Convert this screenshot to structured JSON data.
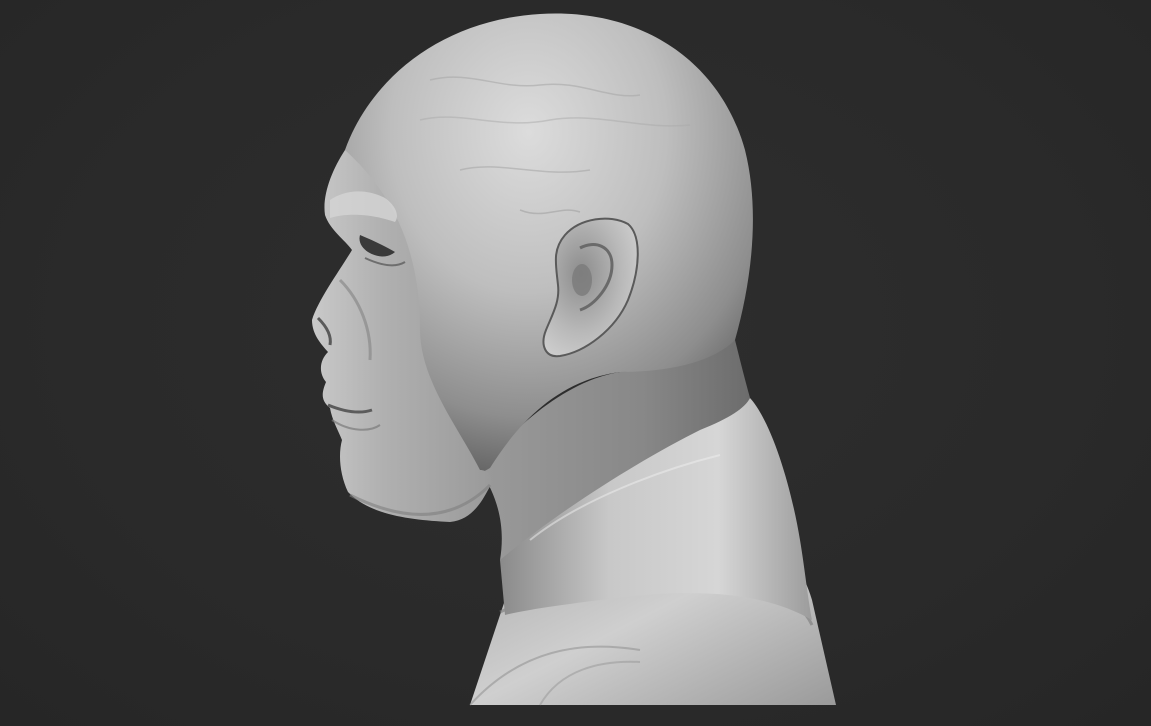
{
  "scene": {
    "subject": "sculpt-bust-profile",
    "background_color": "#2b2b2b",
    "material_color": "#bdbdbd"
  }
}
